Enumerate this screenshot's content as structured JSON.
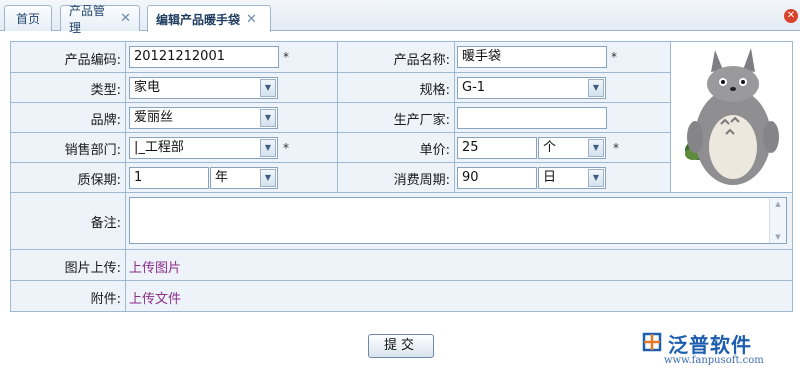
{
  "tabs": [
    {
      "label": "首页",
      "closable": false
    },
    {
      "label": "产品管理",
      "closable": true
    },
    {
      "label": "编辑产品暖手袋",
      "closable": true,
      "active": true
    }
  ],
  "form": {
    "product_code": {
      "label": "产品编码:",
      "value": "20121212001",
      "required": "*"
    },
    "product_name": {
      "label": "产品名称:",
      "value": "暖手袋",
      "required": "*"
    },
    "type": {
      "label": "类型:",
      "value": "家电"
    },
    "spec": {
      "label": "规格:",
      "value": "G-1"
    },
    "brand": {
      "label": "品牌:",
      "value": "爱丽丝"
    },
    "manufacturer": {
      "label": "生产厂家:",
      "value": ""
    },
    "sales_dept": {
      "label": "销售部门:",
      "value": "|_工程部",
      "required": "*"
    },
    "unit_price": {
      "label": "单价:",
      "value": "25",
      "unit": "个",
      "required": "*"
    },
    "warranty": {
      "label": "质保期:",
      "value": "1",
      "unit": "年"
    },
    "consume_period": {
      "label": "消费周期:",
      "value": "90",
      "unit": "日"
    },
    "remark": {
      "label": "备注:",
      "value": ""
    },
    "image_upload": {
      "label": "图片上传:",
      "link": "上传图片"
    },
    "attachment": {
      "label": "附件:",
      "link": "上传文件"
    }
  },
  "submit_label": "提交",
  "logo": {
    "name": "泛普软件",
    "url": "www.fanpusoft.com"
  }
}
